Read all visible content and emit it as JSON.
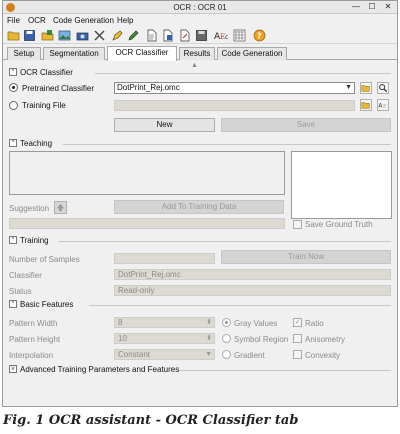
{
  "window": {
    "title": "OCR : OCR 01",
    "minimize": "—",
    "maximize": "☐",
    "close": "✕"
  },
  "menu": [
    "File",
    "OCR",
    "Code Generation",
    "Help"
  ],
  "toolbar_icons": [
    "open-folder-icon",
    "save-icon",
    "load-icon",
    "image-icon",
    "export-icon",
    "camera-icon",
    "pen-icon",
    "pencil-edit-icon",
    "document-icon",
    "save-document-icon",
    "document-export-icon",
    "font-icon",
    "pattern-icon",
    "help-icon"
  ],
  "tabs": [
    "Setup",
    "Segmentation",
    "OCR Classifier",
    "Results",
    "Code Generation"
  ],
  "active_tab": "OCR Classifier",
  "ocr_classifier": {
    "section_title": "OCR Classifier",
    "pretrained_label": "Pretrained Classifier",
    "pretrained_value": "DotPrint_Rej.omc",
    "training_file_label": "Training File",
    "new_button": "New",
    "save_button": "Save"
  },
  "teaching": {
    "section_title": "Teaching",
    "suggestion_label": "Suggestion",
    "add_button": "Add To Training Data",
    "save_ground_truth": "Save Ground Truth"
  },
  "training": {
    "section_title": "Training",
    "num_samples_label": "Number of Samples",
    "train_button": "Train Now",
    "classifier_label": "Classifier",
    "classifier_value": "DotPrint_Rej.omc",
    "status_label": "Status",
    "status_value": "Read-only"
  },
  "basic_features": {
    "section_title": "Basic Features",
    "pattern_width_label": "Pattern Width",
    "pattern_width_value": "8",
    "pattern_height_label": "Pattern Height",
    "pattern_height_value": "10",
    "interpolation_label": "Interpolation",
    "interpolation_value": "Constant",
    "gray_values": "Gray Values",
    "symbol_region": "Symbol Region",
    "gradient": "Gradient",
    "ratio": "Ratio",
    "anisometry": "Anisometry",
    "convexity": "Convexity"
  },
  "advanced": {
    "section_title": "Advanced Training Parameters and Features"
  },
  "caption": "Fig. 1 OCR assistant - OCR Classifier tab",
  "colors": {
    "accent_orange": "#d4801c",
    "folder_yellow": "#e9b733",
    "help_orange": "#f0a020"
  }
}
